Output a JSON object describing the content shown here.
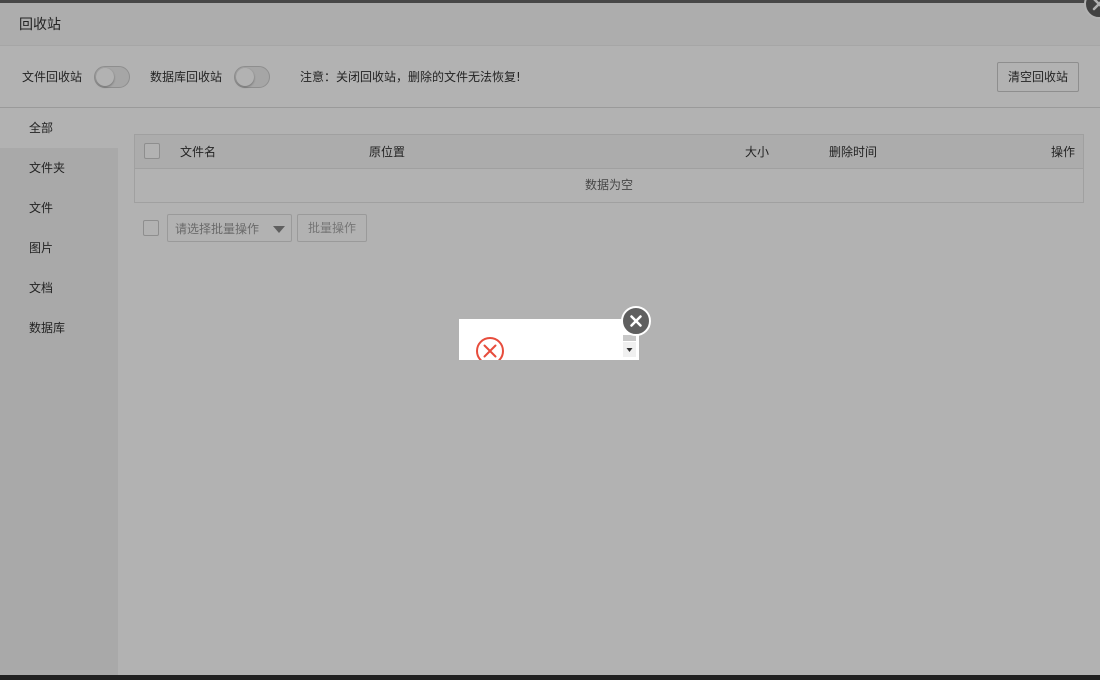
{
  "dialog": {
    "title": "回收站",
    "close_icon": "close-icon"
  },
  "toolbar": {
    "file_recycle_label": "文件回收站",
    "file_recycle_enabled": false,
    "db_recycle_label": "数据库回收站",
    "db_recycle_enabled": false,
    "note": "注意：关闭回收站，删除的文件无法恢复!",
    "clear_button": "清空回收站"
  },
  "sidebar": {
    "items": [
      {
        "label": "全部",
        "active": true
      },
      {
        "label": "文件夹",
        "active": false
      },
      {
        "label": "文件",
        "active": false
      },
      {
        "label": "图片",
        "active": false
      },
      {
        "label": "文档",
        "active": false
      },
      {
        "label": "数据库",
        "active": false
      }
    ]
  },
  "table": {
    "columns": [
      "文件名",
      "原位置",
      "大小",
      "删除时间",
      "操作"
    ],
    "empty_text": "数据为空"
  },
  "batch": {
    "select_placeholder": "请选择批量操作",
    "button": "批量操作"
  },
  "popup": {
    "icon": "error-circle-icon",
    "icon_color": "#e74c3c"
  },
  "colors": {
    "overlay": "rgba(0,0,0,0.3)",
    "error": "#e74c3c",
    "close_bg": "#5f5f5f"
  }
}
